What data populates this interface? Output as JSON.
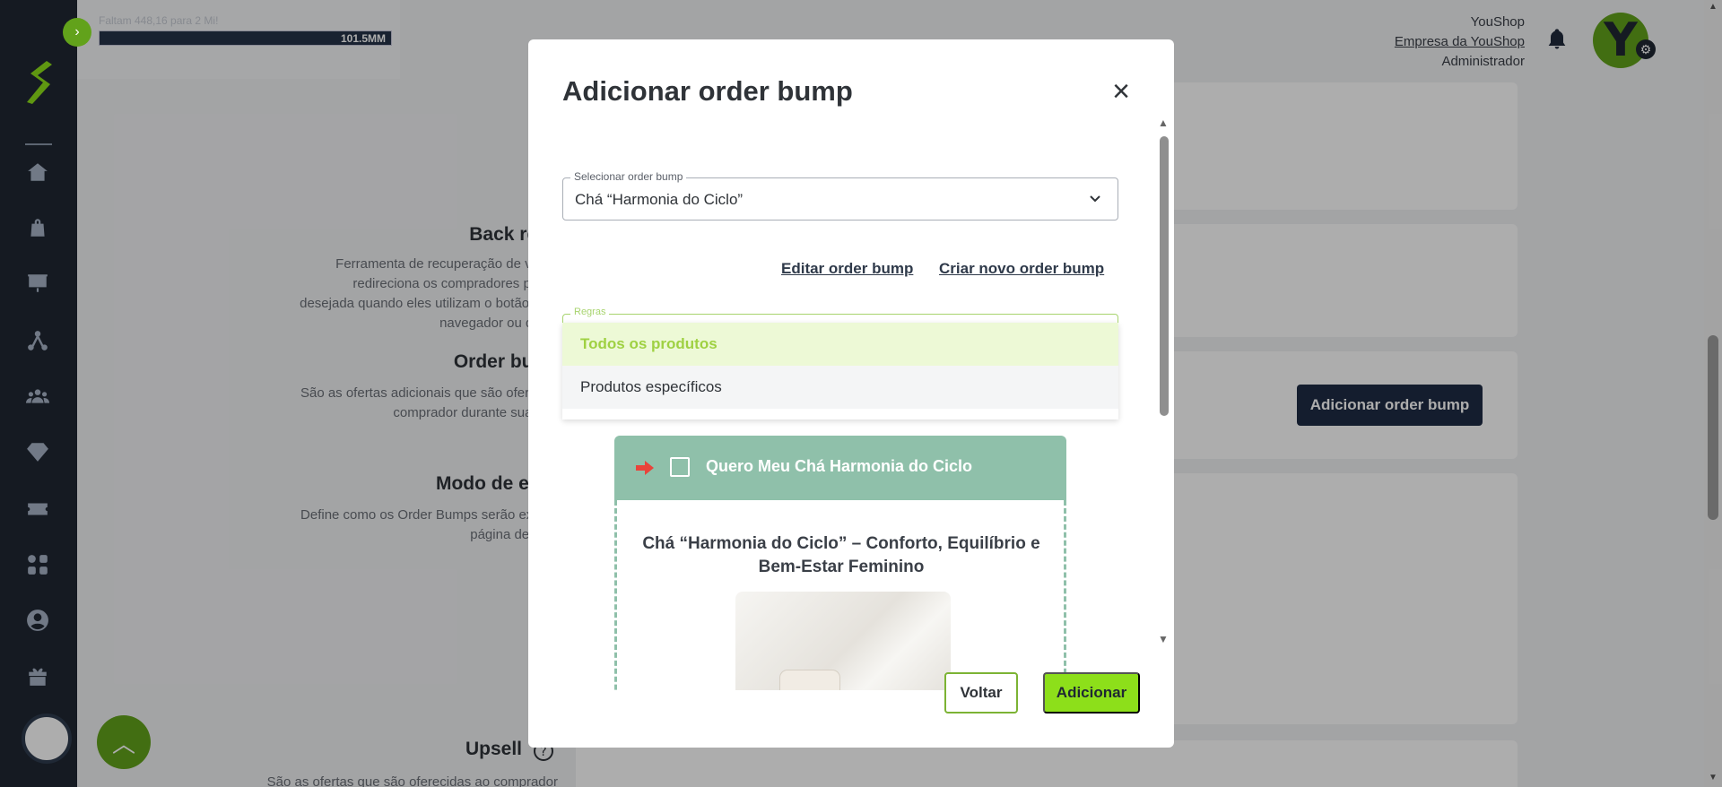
{
  "topbar": {
    "progress_label": "Faltam 448,16 para 2 Mi!",
    "progress_text": "101.5MM",
    "account_name": "YouShop",
    "company_link": "Empresa da YouShop",
    "role": "Administrador",
    "avatar_letter": "Y"
  },
  "page": {
    "sections": [
      {
        "title": "Back redir",
        "desc": [
          "Ferramenta de recuperação de venda",
          "redireciona os compradores para a",
          "desejada quando eles utilizam o botão volta",
          "navegador ou do cel"
        ]
      },
      {
        "title": "Order bump",
        "desc": [
          "São as ofertas adicionais que são oferecida",
          "comprador durante sua com"
        ]
      },
      {
        "title": "Modo de exibi",
        "desc": [
          "Define como os Order Bumps serão exibido",
          "página de chec"
        ]
      },
      {
        "title": "Upsell",
        "desc": [
          "São as ofertas que são oferecidas ao comprador"
        ]
      }
    ],
    "add_button": "Adicionar order bump"
  },
  "modal": {
    "title": "Adicionar order bump",
    "close_label": "×",
    "select": {
      "legend": "Selecionar order bump",
      "value": "Chá “Harmonia do Ciclo”"
    },
    "links": {
      "edit": "Editar order bump",
      "create": "Criar novo order bump"
    },
    "rules": {
      "legend": "Regras"
    },
    "dropdown_options": [
      "Todos os produtos",
      "Produtos específicos"
    ],
    "bump": {
      "header_text": "Quero Meu Chá Harmonia do Ciclo",
      "title": "Chá “Harmonia do Ciclo” – Conforto, Equilíbrio e Bem-Estar Feminino"
    },
    "buttons": {
      "back": "Voltar",
      "add": "Adicionar"
    }
  },
  "colors": {
    "sidebar": "#1f2733",
    "accent_green": "#8ddf1a",
    "bump_header": "#8fc0aa",
    "navy_button": "#1e2b44"
  },
  "icons": [
    "chevron-right-icon",
    "home-icon",
    "bag-icon",
    "presentation-icon",
    "network-icon",
    "users-icon",
    "diamond-icon",
    "ticket-icon",
    "apps-icon",
    "user-circle-icon",
    "gift-icon",
    "bell-icon",
    "gear-icon",
    "close-icon",
    "chevron-down-icon",
    "arrow-right-icon",
    "chevron-up-icon",
    "help-icon"
  ]
}
